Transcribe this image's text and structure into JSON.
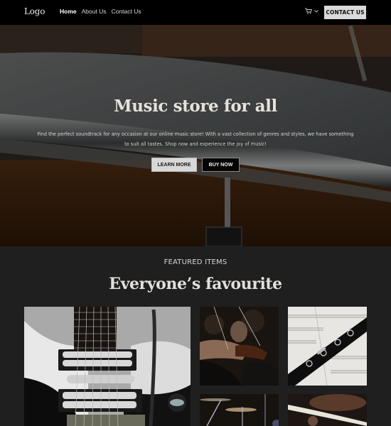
{
  "nav": {
    "logo": "Logo",
    "links": [
      {
        "label": "Home",
        "active": true
      },
      {
        "label": "About Us",
        "active": false
      },
      {
        "label": "Contact Us",
        "active": false
      }
    ],
    "cart_icon": "cart-icon",
    "dropdown_icon": "chevron-down-icon",
    "contact_button": "CONTACT US"
  },
  "hero": {
    "title": "Music store for all",
    "text": "Find the perfect soundtrack for any occasion at our online music store! With a vast collection of genres and styles, we have something to suit all tastes. Shop now and experience the joy of music!",
    "learn_more": "LEARN MORE",
    "buy_now": "BUY NOW",
    "background": "drum-snare-photo"
  },
  "featured": {
    "label": "FEATURED ITEMS",
    "title": "Everyone’s favourite",
    "items": [
      {
        "image": "electric-guitar-photo"
      },
      {
        "image": "violin-orchestra-photo"
      },
      {
        "image": "clarinet-sheet-music-photo"
      },
      {
        "image": "drum-cymbals-photo"
      },
      {
        "image": "trumpet-closeup-photo"
      }
    ]
  },
  "colors": {
    "nav_bg": "#000000",
    "page_bg": "#1f1f1f",
    "button_light": "#d9d9d9",
    "button_dark": "#050505",
    "text_light": "#e6e2dc"
  }
}
